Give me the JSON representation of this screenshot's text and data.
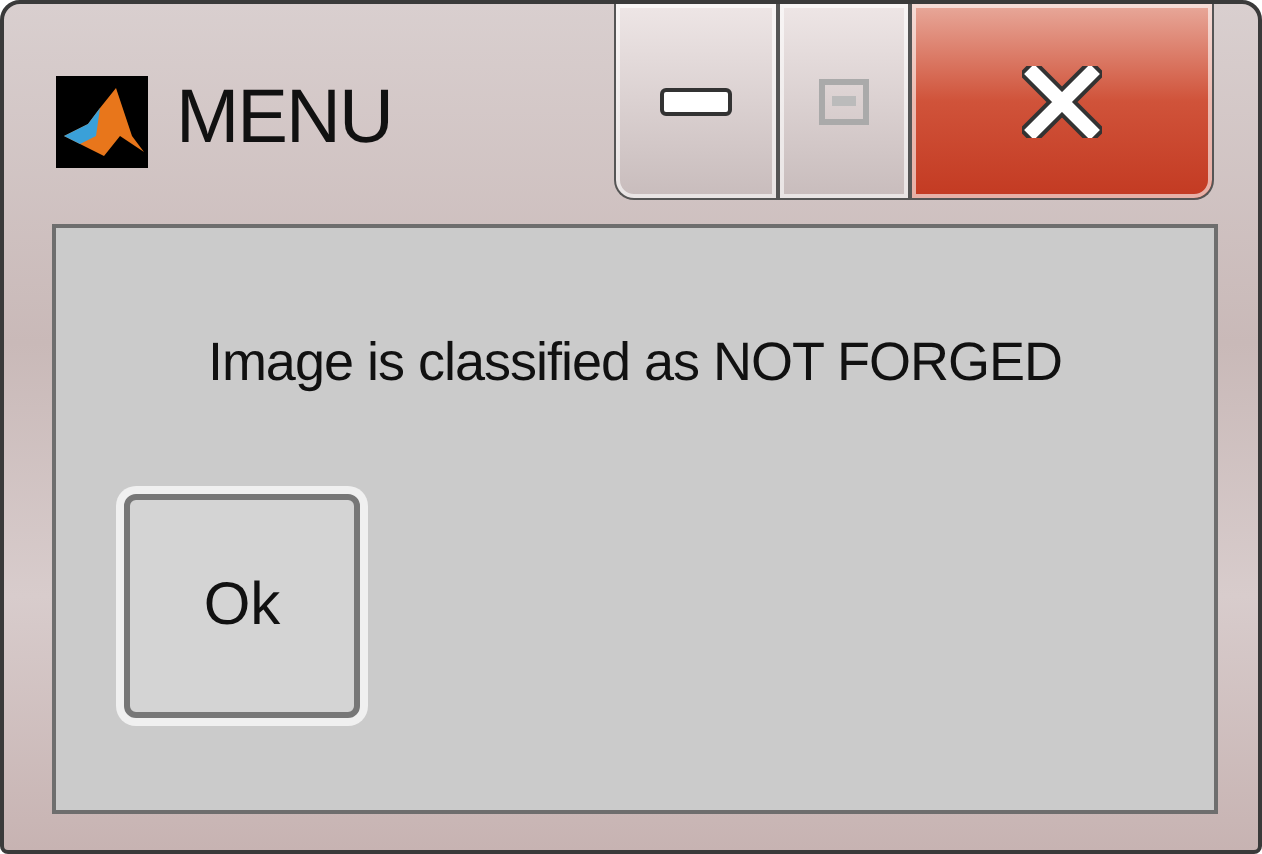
{
  "window": {
    "title": "MENU"
  },
  "message": "Image is classified as NOT FORGED",
  "buttons": [
    "Ok"
  ]
}
